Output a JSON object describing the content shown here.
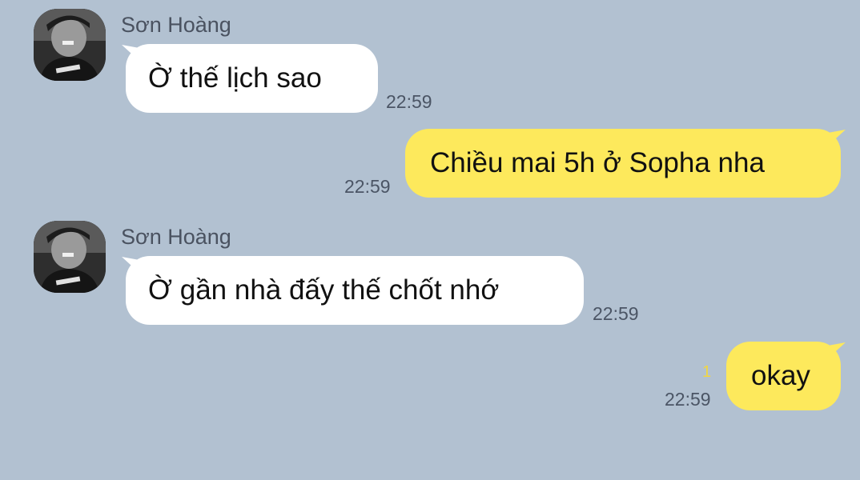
{
  "colors": {
    "background": "#b2c1d1",
    "incoming_bubble": "#ffffff",
    "outgoing_bubble": "#fde95c",
    "unread_marker": "#f2d640"
  },
  "messages": [
    {
      "direction": "incoming",
      "sender": "Sơn Hoàng",
      "avatar_icon": "user-avatar-photo",
      "text": "Ờ thế lịch sao",
      "time": "22:59"
    },
    {
      "direction": "outgoing",
      "text": "Chiều mai 5h ở Sopha nha",
      "time": "22:59"
    },
    {
      "direction": "incoming",
      "sender": "Sơn Hoàng",
      "avatar_icon": "user-avatar-photo",
      "text": "Ờ gần nhà đấy thế chốt nhớ",
      "time": "22:59"
    },
    {
      "direction": "outgoing",
      "text": "okay",
      "time": "22:59",
      "unread": "1"
    }
  ]
}
